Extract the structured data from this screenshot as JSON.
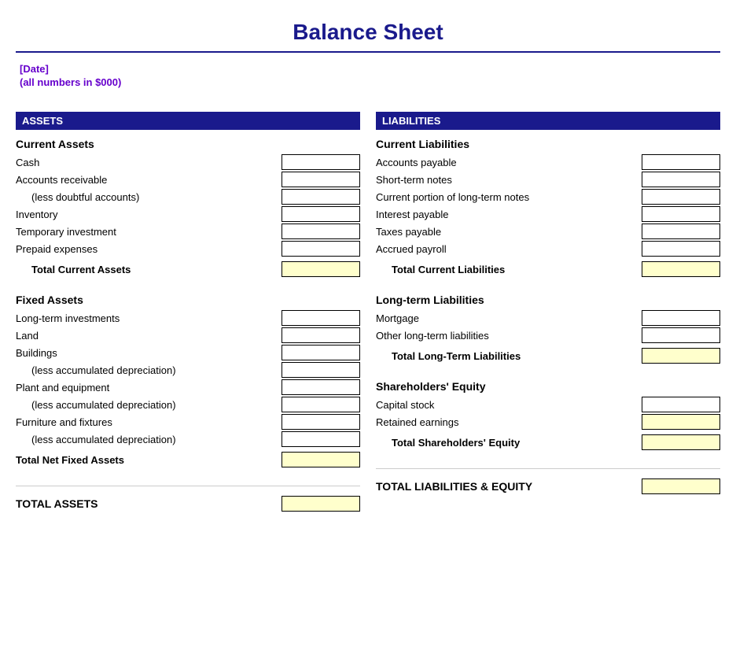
{
  "title": "Balance Sheet",
  "date": "[Date]",
  "subtitle": "(all numbers in $000)",
  "assets": {
    "header": "ASSETS",
    "current_assets": {
      "title": "Current Assets",
      "items": [
        {
          "label": "Cash",
          "indented": false
        },
        {
          "label": "Accounts receivable",
          "indented": false
        },
        {
          "label": "(less doubtful accounts)",
          "indented": true
        },
        {
          "label": "Inventory",
          "indented": false
        },
        {
          "label": "Temporary investment",
          "indented": false
        },
        {
          "label": "Prepaid expenses",
          "indented": false
        }
      ],
      "total_label": "Total Current Assets"
    },
    "fixed_assets": {
      "title": "Fixed Assets",
      "items": [
        {
          "label": "Long-term investments",
          "indented": false
        },
        {
          "label": "Land",
          "indented": false
        },
        {
          "label": "Buildings",
          "indented": false
        },
        {
          "label": "(less accumulated depreciation)",
          "indented": true
        },
        {
          "label": "Plant and equipment",
          "indented": false
        },
        {
          "label": "(less accumulated depreciation)",
          "indented": true
        },
        {
          "label": "Furniture and fixtures",
          "indented": false
        },
        {
          "label": "(less accumulated depreciation)",
          "indented": true
        }
      ],
      "total_label": "Total Net Fixed Assets"
    },
    "total_label": "TOTAL ASSETS"
  },
  "liabilities": {
    "header": "LIABILITIES",
    "current_liabilities": {
      "title": "Current Liabilities",
      "items": [
        {
          "label": "Accounts payable",
          "indented": false
        },
        {
          "label": "Short-term notes",
          "indented": false
        },
        {
          "label": "Current portion of long-term notes",
          "indented": false
        },
        {
          "label": "Interest payable",
          "indented": false
        },
        {
          "label": "Taxes payable",
          "indented": false
        },
        {
          "label": "Accrued payroll",
          "indented": false
        }
      ],
      "total_label": "Total Current Liabilities"
    },
    "long_term_liabilities": {
      "title": "Long-term Liabilities",
      "items": [
        {
          "label": "Mortgage",
          "indented": false
        },
        {
          "label": "Other long-term liabilities",
          "indented": false
        }
      ],
      "total_label": "Total Long-Term Liabilities"
    },
    "shareholders_equity": {
      "title": "Shareholders' Equity",
      "items": [
        {
          "label": "Capital stock",
          "indented": false
        },
        {
          "label": "Retained earnings",
          "indented": false
        }
      ],
      "total_label": "Total Shareholders' Equity"
    },
    "total_label": "TOTAL LIABILITIES & EQUITY"
  }
}
